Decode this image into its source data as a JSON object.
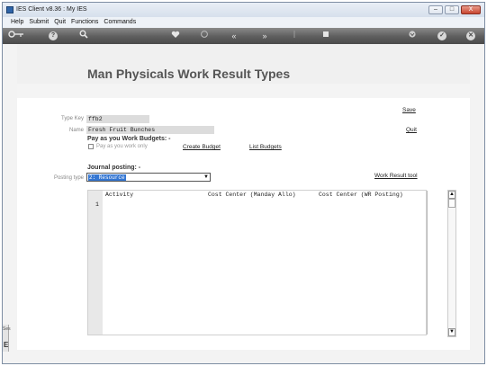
{
  "window": {
    "title": "IES Client v8.36 : My IES",
    "minimize": "–",
    "maximize": "□",
    "close": "X"
  },
  "menu": [
    "Help",
    "Submit",
    "Quit",
    "Functions",
    "Commands"
  ],
  "toolbar": {
    "icons": [
      "key-icon",
      "help-icon",
      "search-icon",
      "heart-icon",
      "refresh-icon",
      "rewind-icon",
      "fast-forward-icon",
      "up-icon",
      "stop-icon",
      "down-icon",
      "check-icon",
      "close-icon"
    ],
    "help_glyph": "?",
    "check_glyph": "✓",
    "close_glyph": "✕",
    "rewind_glyph": "«",
    "ff_glyph": "»",
    "colors": {
      "toolbar_bg": "#5d5d5d"
    }
  },
  "page": {
    "title": "Man Physicals Work Result Types"
  },
  "form": {
    "type_key_label": "Type Key",
    "type_key_value": "ffb2",
    "name_label": "Name",
    "name_value": "Fresh Fruit Bunches",
    "save_link": "Save",
    "quit_link": "Quit",
    "pay_section": "Pay as you Work Budgets: -",
    "pay_checkbox_label": "Pay as you work only",
    "create_budget_link": "Create Budget",
    "list_budgets_link": "List Budgets",
    "journal_section": "Journal posting: -",
    "posting_type_label": "Posting type",
    "posting_type_value": "2: Resource",
    "work_result_tool_link": "Work Result tool"
  },
  "grid": {
    "columns": [
      "Activity",
      "Cost Center (Manday Allo)",
      "Cost Center (WR Posting)"
    ],
    "rows": [
      {
        "num": "1"
      }
    ]
  },
  "side_tab": {
    "label": "Ses",
    "letter": "E"
  }
}
